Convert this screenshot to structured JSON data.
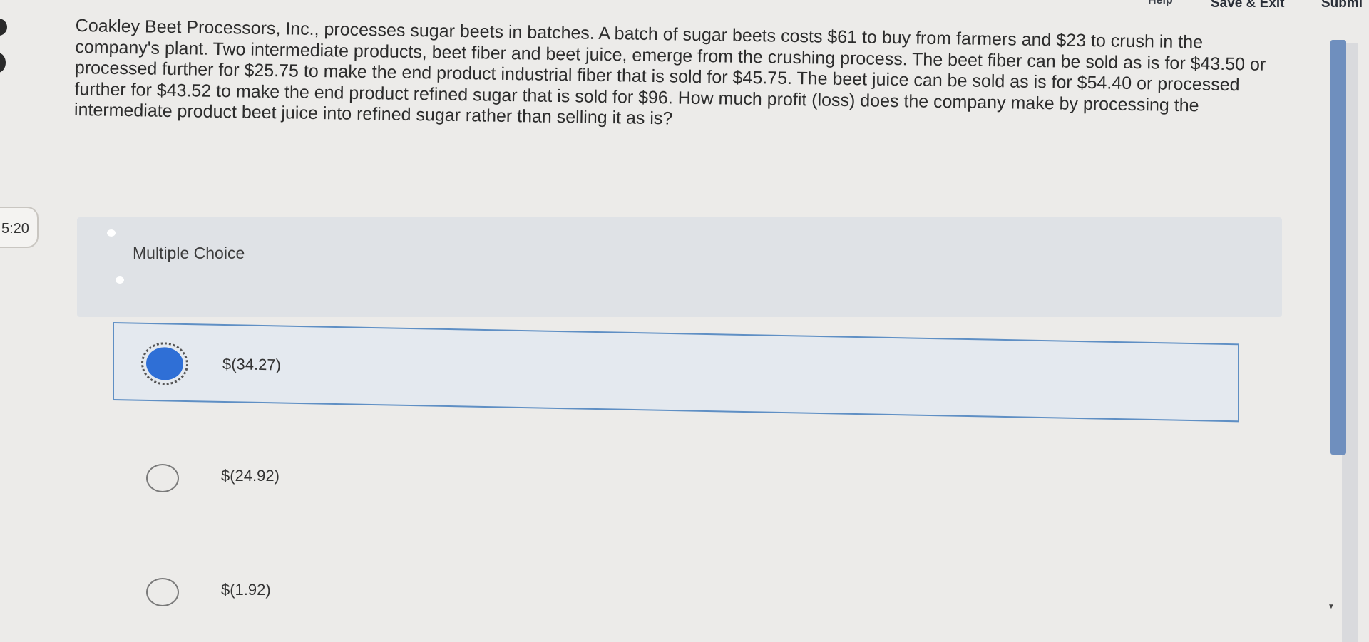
{
  "topbar": {
    "help": "Help",
    "save_exit": "Save & Exit",
    "submit": "Submi"
  },
  "timer": "5:20",
  "question": {
    "text": "Coakley Beet Processors, Inc., processes sugar beets in batches. A batch of sugar beets costs $61 to buy from farmers and $23 to crush in the company's plant. Two intermediate products, beet fiber and beet juice, emerge from the crushing process. The beet fiber can be sold as is for $43.50 or processed further for $25.75 to make the end product industrial fiber that is sold for $45.75. The beet juice can be sold as is for $54.40 or processed further for $43.52 to make the end product refined sugar that is sold for $96. How much profit (loss) does the company make by processing the intermediate product beet juice into refined sugar rather than selling it as is?"
  },
  "answer": {
    "type_label": "Multiple Choice",
    "options": [
      {
        "label": "$(34.27)",
        "selected": true
      },
      {
        "label": "$(24.92)",
        "selected": false
      },
      {
        "label": "$(1.92)",
        "selected": false
      }
    ]
  },
  "colors": {
    "selected_radio": "#2f6fd6",
    "selected_border": "#5f8fc4",
    "scrollbar_thumb": "#6f8fbe"
  }
}
